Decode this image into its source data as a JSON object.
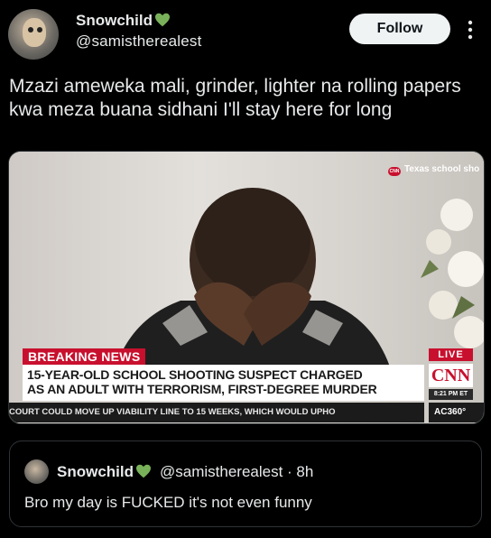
{
  "author": {
    "display_name": "Snowchild",
    "verified_emoji": "green-heart",
    "handle": "@samistherealеst"
  },
  "follow_label": "Follow",
  "tweet_text": "Mzazi ameweka mali, grinder, lighter na rolling papers kwa meza buana sidhani I'll stay here for long",
  "media": {
    "top_tag": "Texas school sho",
    "top_tag_logo": "CNN",
    "breaking_label": "BREAKING NEWS",
    "headline_line1": "15-YEAR-OLD SCHOOL SHOOTING SUSPECT CHARGED",
    "headline_line2": "AS AN ADULT WITH TERRORISM, FIRST-DEGREE MURDER",
    "ticker": "COURT COULD MOVE UP VIABILITY LINE TO 15 WEEKS, WHICH WOULD UPHO",
    "live_label": "LIVE",
    "network": "CNN",
    "time": "8:21 PM ET",
    "show": "AC360°"
  },
  "quoted": {
    "display_name": "Snowchild",
    "handle_time": "@samistherealеst · 8h",
    "text": "Bro my day is FUCKED it's not even funny"
  },
  "colors": {
    "background": "#000000",
    "text": "#e7e9ea",
    "follow_bg": "#eff3f4",
    "cnn_red": "#c8102e",
    "heart_green": "#78b159"
  }
}
